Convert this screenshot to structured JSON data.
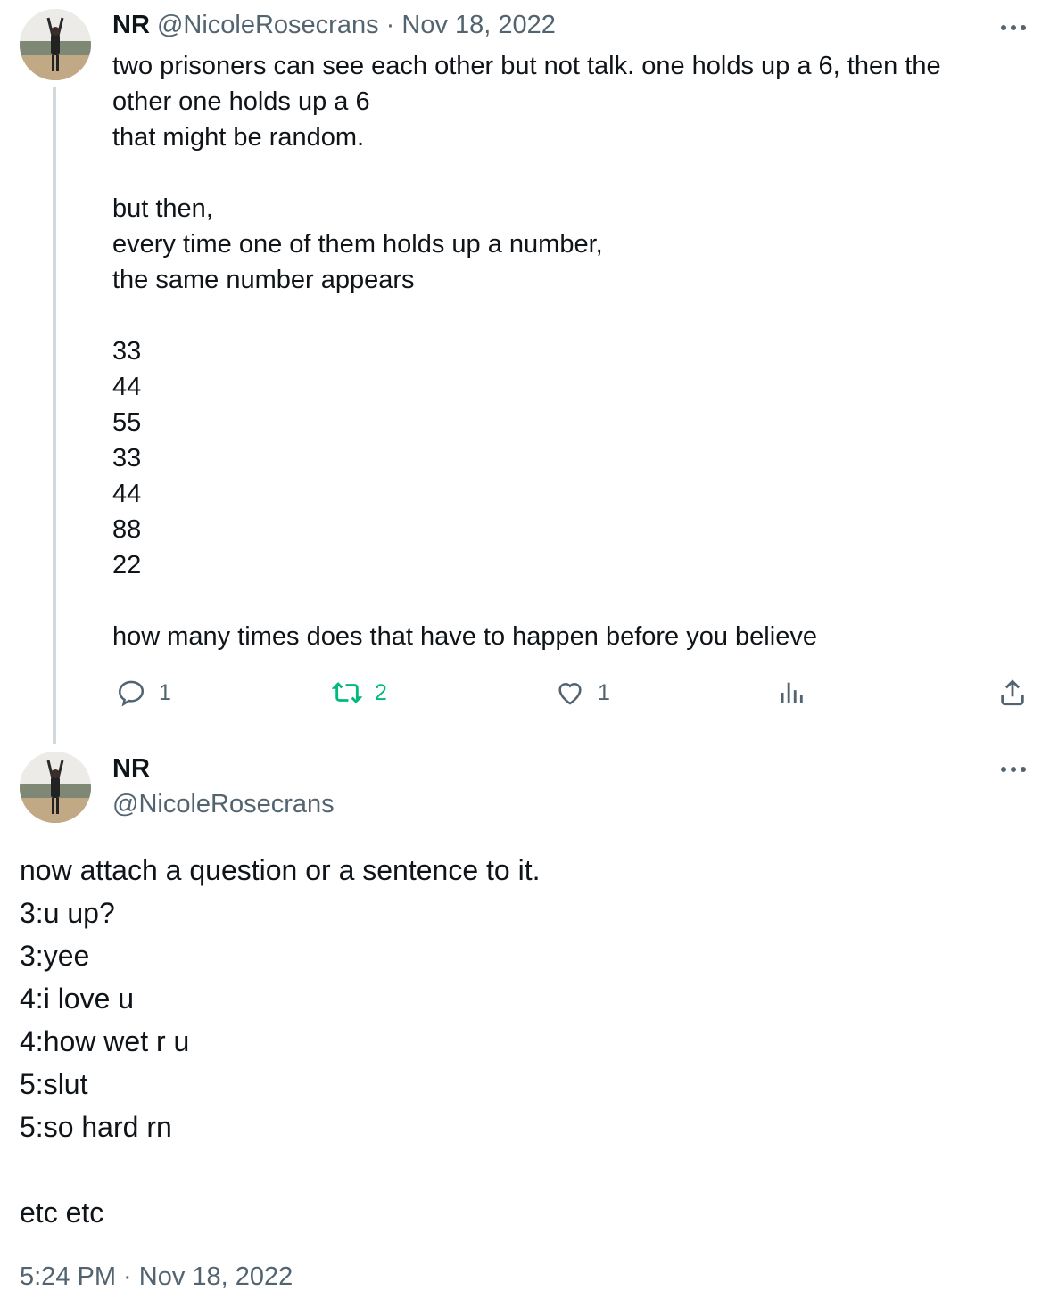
{
  "reply_tweet": {
    "display_name": "NR",
    "handle": "@NicoleRosecrans",
    "separator": "·",
    "date": "Nov 18, 2022",
    "text": "two prisoners can see each other but not talk. one holds up a 6, then the\nother one holds up a 6\nthat might be random.\n\nbut then,\nevery time one of them holds up a number,\nthe same number appears\n\n33\n44\n55\n33\n44\n88\n22\n\nhow many times does that have to happen before you believe",
    "actions": {
      "reply_count": "1",
      "retweet_count": "2",
      "like_count": "1"
    },
    "colors": {
      "retweet": "#00ba7c",
      "muted": "#536471"
    }
  },
  "main_tweet": {
    "display_name": "NR",
    "handle": "@NicoleRosecrans",
    "text": "now attach a question or a sentence to it.\n3:u up?\n3:yee\n4:i love u\n4:how wet r u\n5:slut\n5:so hard rn\n\netc etc",
    "timestamp": "5:24 PM · Nov 18, 2022"
  },
  "icons": [
    "avatar",
    "more-icon",
    "reply-icon",
    "retweet-icon",
    "like-icon",
    "views-icon",
    "share-icon"
  ]
}
